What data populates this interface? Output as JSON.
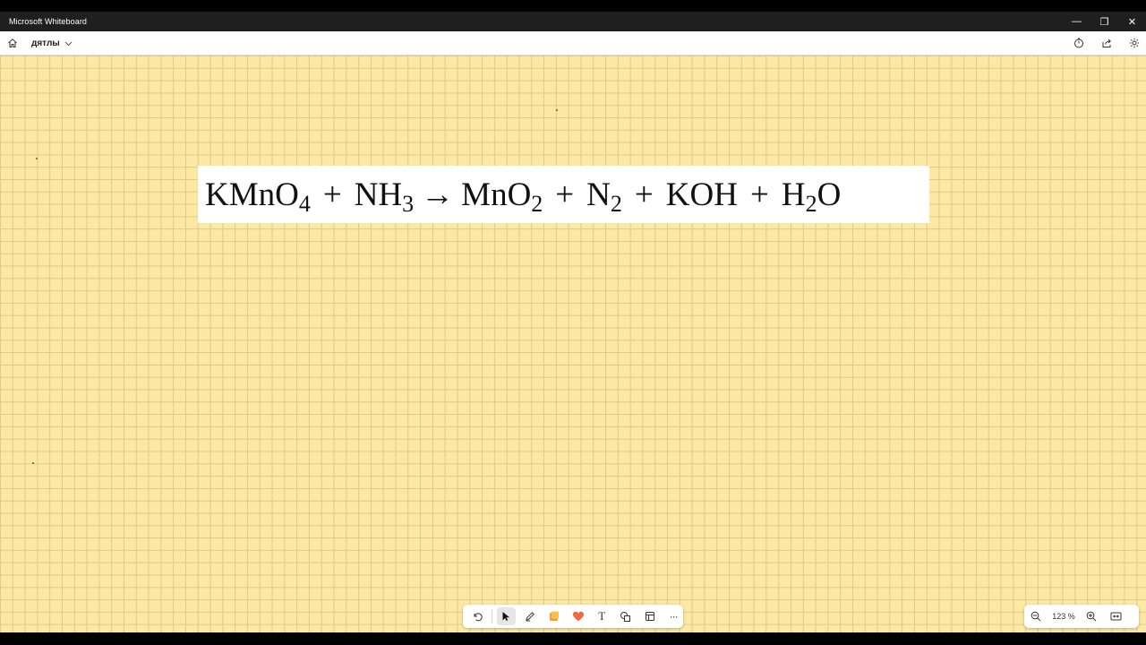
{
  "window": {
    "title": "Microsoft Whiteboard",
    "controls": {
      "minimize": "—",
      "restore": "❐",
      "close": "✕"
    }
  },
  "appbar": {
    "board_name": "дятлы",
    "icons": [
      "home-icon",
      "chevron-down-icon",
      "timer-icon",
      "share-icon",
      "gear-icon"
    ]
  },
  "canvas": {
    "background_color": "#fde9a3",
    "grid_color": "#ddc98a",
    "equation": {
      "reactant1": "KMnO",
      "reactant1_sub": "4",
      "plus1": "+",
      "reactant2": "NH",
      "reactant2_sub": "3",
      "arrow": "→",
      "product1": "MnO",
      "product1_sub": "2",
      "plus2": "+",
      "product2": "N",
      "product2_sub": "2",
      "plus3": "+",
      "product3": "KOH",
      "plus4": "+",
      "product4_a": "H",
      "product4_sub": "2",
      "product4_b": "O"
    }
  },
  "toolbar": {
    "tools": [
      "undo-icon",
      "select-icon",
      "pen-icon",
      "sticky-note-icon",
      "reaction-icon",
      "text-icon",
      "shapes-icon",
      "templates-icon",
      "more-icon"
    ],
    "text_tool_label": "T",
    "more_label": "···"
  },
  "zoom": {
    "level": "123 %",
    "icons": [
      "zoom-out-icon",
      "zoom-in-icon",
      "fit-to-screen-icon"
    ]
  }
}
